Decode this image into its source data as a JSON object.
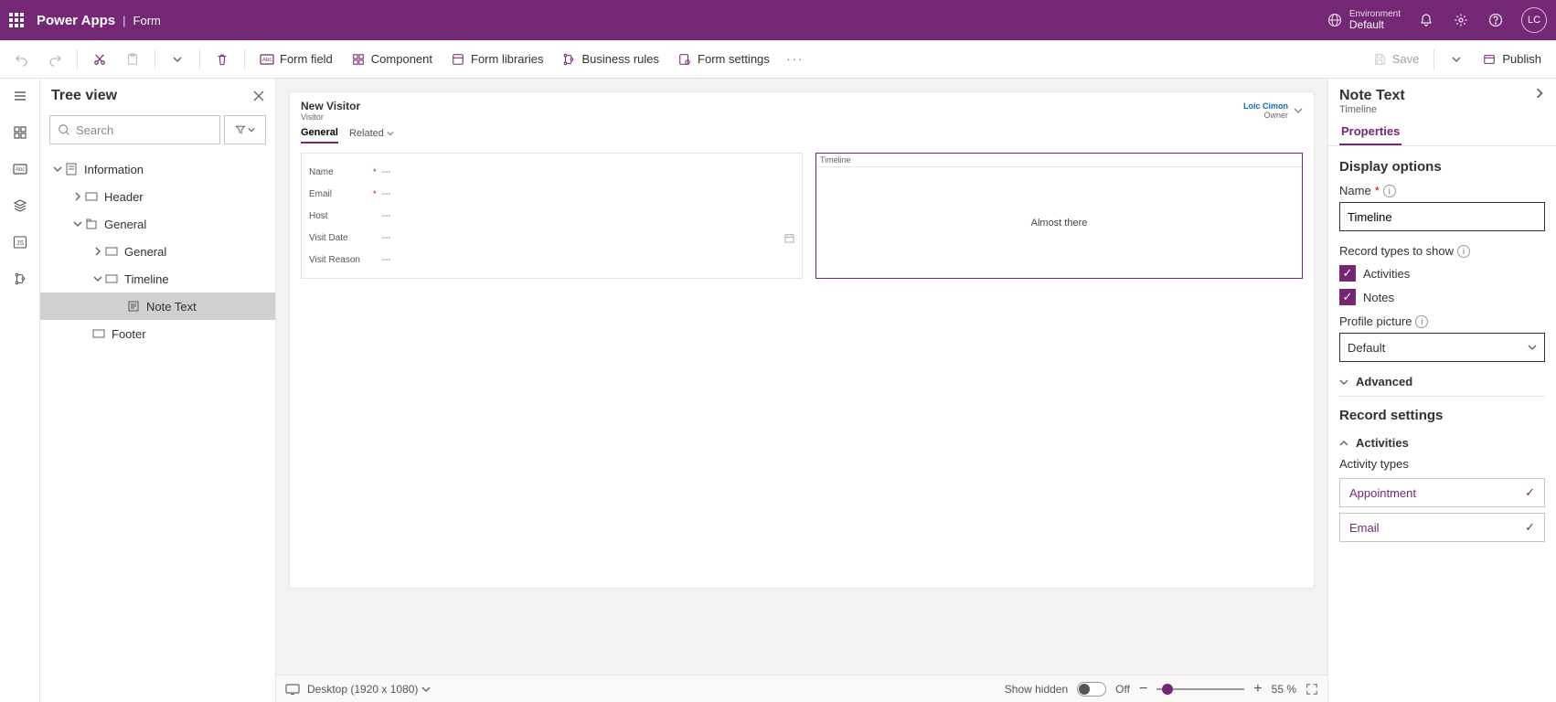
{
  "header": {
    "brand": "Power Apps",
    "page": "Form",
    "env_label": "Environment",
    "env_name": "Default",
    "avatar": "LC"
  },
  "cmd": {
    "form_field": "Form field",
    "component": "Component",
    "form_libraries": "Form libraries",
    "business_rules": "Business rules",
    "form_settings": "Form settings",
    "save": "Save",
    "publish": "Publish"
  },
  "tree": {
    "title": "Tree view",
    "search_placeholder": "Search",
    "items": {
      "information": "Information",
      "header": "Header",
      "general_top": "General",
      "general_sub": "General",
      "timeline": "Timeline",
      "note_text": "Note Text",
      "footer": "Footer"
    }
  },
  "form": {
    "title": "New Visitor",
    "sub": "Visitor",
    "owner_name": "Loic Cimon",
    "owner_label": "Owner",
    "tabs": {
      "general": "General",
      "related": "Related"
    },
    "fields": {
      "name": "Name",
      "email": "Email",
      "host": "Host",
      "visit_date": "Visit Date",
      "visit_reason": "Visit Reason",
      "placeholder": "---"
    },
    "timeline_label": "Timeline",
    "timeline_msg": "Almost there"
  },
  "footer": {
    "device": "Desktop (1920 x 1080)",
    "show_hidden": "Show hidden",
    "toggle": "Off",
    "zoom": "55 %"
  },
  "props": {
    "title": "Note Text",
    "sub": "Timeline",
    "tab": "Properties",
    "display_options": "Display options",
    "name_label": "Name",
    "name_value": "Timeline",
    "record_types": "Record types to show",
    "activities": "Activities",
    "notes": "Notes",
    "profile_picture": "Profile picture",
    "profile_value": "Default",
    "advanced": "Advanced",
    "record_settings": "Record settings",
    "activities_section": "Activities",
    "activity_types": "Activity types",
    "appointment": "Appointment",
    "email": "Email"
  }
}
